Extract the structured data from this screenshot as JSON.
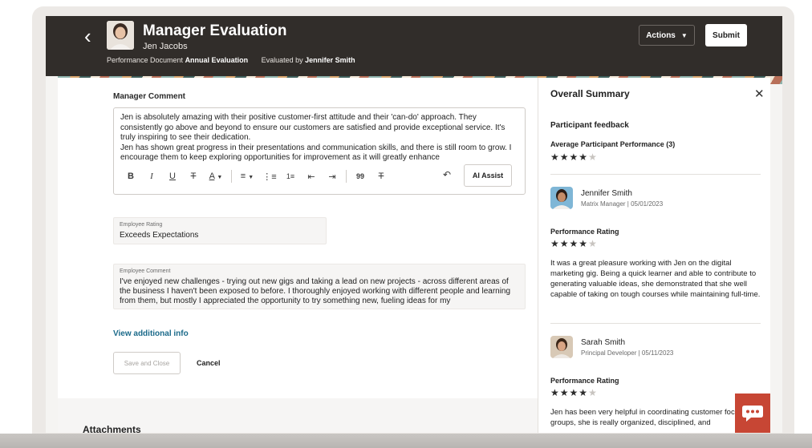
{
  "header": {
    "back_icon": "chevron-left-icon",
    "title": "Manager Evaluation",
    "employee_name": "Jen Jacobs",
    "doc_label": "Performance Document",
    "doc_value": "Annual Evaluation",
    "evaluated_label": "Evaluated by",
    "evaluated_value": "Jennifer Smith",
    "actions_label": "Actions",
    "submit_label": "Submit"
  },
  "main": {
    "manager_comment_label": "Manager Comment",
    "manager_comment_text": [
      "Jen is absolutely amazing with their positive customer-first attitude and their 'can-do' approach. They consistently go above and beyond to ensure our customers are satisfied and provide exceptional service. It's truly inspiring to see their dedication.",
      "Jen has shown great progress in their presentations and communication skills, and there is still room to grow. I encourage them to keep exploring opportunities for improvement as it will greatly enhance"
    ],
    "toolbar": {
      "bold": "B",
      "italic": "I",
      "underline": "U",
      "strike": "T",
      "font_color": "A",
      "quote": "99",
      "ai_assist_label": "AI Assist"
    },
    "employee_rating_label": "Employee Rating",
    "employee_rating_value": "Exceeds Expectations",
    "employee_comment_label": "Employee Comment",
    "employee_comment_text": "I've enjoyed new challenges - trying out new gigs and taking a lead on new projects - across different areas of the business I haven't been exposed to before. I thoroughly enjoyed working with different people and learning from them, but mostly I appreciated the opportunity to try something new, fueling ideas for my",
    "view_info_label": "View additional info",
    "save_close_label": "Save and Close",
    "cancel_label": "Cancel",
    "attachments_label": "Attachments"
  },
  "summary": {
    "title": "Overall Summary",
    "participant_feedback_label": "Participant feedback",
    "avg_label": "Average Participant Performance (3)",
    "avg_rating": 4,
    "max_rating": 5,
    "participants": [
      {
        "name": "Jennifer Smith",
        "role": "Matrix Manager | 05/01/2023",
        "rating_label": "Performance Rating",
        "rating": 4,
        "comment": "It was a great pleasure working with Jen on the digital marketing gig. Being a quick learner and able to contribute to generating valuable ideas, she demonstrated that she well capable of taking on tough courses while maintaining full-time."
      },
      {
        "name": "Sarah Smith",
        "role": "Principal Developer | 05/11/2023",
        "rating_label": "Performance Rating",
        "rating": 4,
        "comment": "Jen has been very helpful in coordinating customer focus groups, she is really organized, disciplined, and"
      }
    ]
  },
  "colors": {
    "header_bg": "#312d2a",
    "link": "#1b6a8a",
    "chat_bg": "#c74634"
  }
}
